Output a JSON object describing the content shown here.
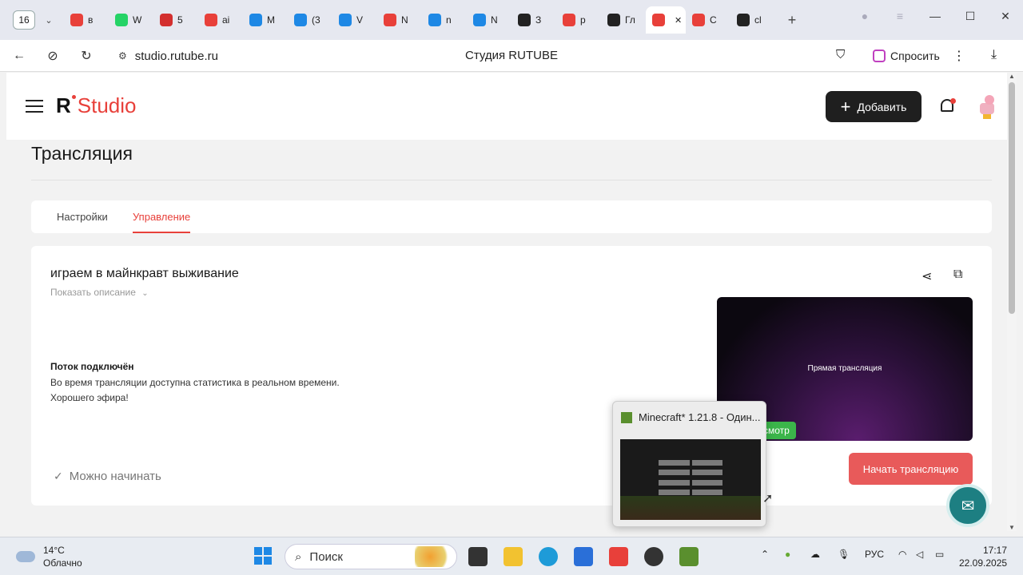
{
  "browser": {
    "tab_count": "16",
    "tabs": [
      {
        "label": "в",
        "icon": "yandex-icon",
        "color": "#e8403a"
      },
      {
        "label": "W",
        "icon": "whatsapp-icon",
        "color": "#25d366"
      },
      {
        "label": "5",
        "icon": "pdf-icon",
        "color": "#d32f2f"
      },
      {
        "label": "ai",
        "icon": "yandex-icon",
        "color": "#e8403a"
      },
      {
        "label": "M",
        "icon": "mail-icon",
        "color": "#1e88e5"
      },
      {
        "label": "(3",
        "icon": "chat-icon",
        "color": "#1e88e5"
      },
      {
        "label": "V",
        "icon": "chat-icon",
        "color": "#1e88e5"
      },
      {
        "label": "N",
        "icon": "yandex-icon",
        "color": "#e8403a"
      },
      {
        "label": "n",
        "icon": "docs-icon",
        "color": "#1e88e5"
      },
      {
        "label": "N",
        "icon": "docs-icon",
        "color": "#1e88e5"
      },
      {
        "label": "З",
        "icon": "download-icon",
        "color": "#222222"
      },
      {
        "label": "p",
        "icon": "yandex-icon",
        "color": "#e8403a"
      },
      {
        "label": "Гл",
        "icon": "page-icon",
        "color": "#222222"
      },
      {
        "label": "",
        "icon": "rutube-icon",
        "color": "#e8403a",
        "active": true
      },
      {
        "label": "C",
        "icon": "rutube-icon",
        "color": "#e8403a"
      },
      {
        "label": "cl",
        "icon": "roblox-icon",
        "color": "#222222"
      }
    ],
    "url": "studio.rutube.ru",
    "page_title": "Студия RUTUBE",
    "ask_label": "Спросить"
  },
  "header": {
    "logo_r": "R",
    "logo_text": "Studio",
    "add_label": "Добавить"
  },
  "page": {
    "title": "Трансляция",
    "tabs": [
      "Настройки",
      "Управление"
    ],
    "active_tab": "Управление"
  },
  "stream": {
    "title": "играем в майнкравт выживание",
    "show_description": "Показать описание",
    "status_title": "Поток подключён",
    "status_line1": "Во время трансляции доступна статистика в реальном времени.",
    "status_line2": "Хорошего эфира!",
    "ready_label": "Можно начинать",
    "preview_label": "Прямая трансляция",
    "preview_badge": "смотр",
    "start_label": "Начать трансляцию"
  },
  "taskbar_popup": {
    "title": "Minecraft* 1.21.8 - Один..."
  },
  "taskbar": {
    "weather_temp": "14°C",
    "weather_desc": "Облачно",
    "search_label": "Поиск",
    "language": "РУС",
    "time": "17:17",
    "date": "22.09.2025"
  },
  "colors": {
    "accent": "#e8403a",
    "start_button": "#e85a5a",
    "live_badge": "#3bb54a",
    "chat_fab": "#1d7f82"
  }
}
